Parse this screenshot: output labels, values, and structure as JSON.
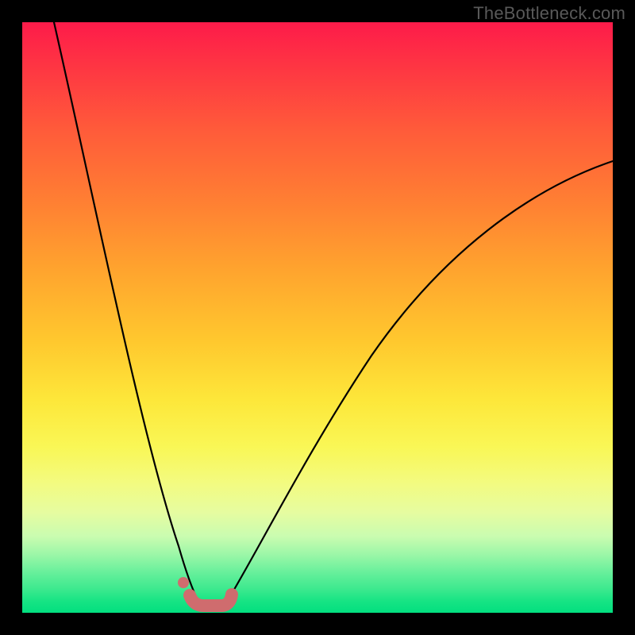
{
  "watermark": "TheBottleneck.com",
  "chart_data": {
    "type": "line",
    "title": "",
    "xlabel": "",
    "ylabel": "",
    "xlim": [
      0,
      1
    ],
    "ylim": [
      0,
      1
    ],
    "background_gradient": {
      "orientation": "vertical",
      "stops": [
        {
          "pos": 0.0,
          "color": "#fd1b4a"
        },
        {
          "pos": 0.18,
          "color": "#ff5a3a"
        },
        {
          "pos": 0.42,
          "color": "#ffa42e"
        },
        {
          "pos": 0.64,
          "color": "#fde73a"
        },
        {
          "pos": 0.83,
          "color": "#e6fca0"
        },
        {
          "pos": 1.0,
          "color": "#02df7f"
        }
      ]
    },
    "series": [
      {
        "name": "bottleneck-curve",
        "color": "#000000",
        "x": [
          0.05,
          0.1,
          0.15,
          0.2,
          0.23,
          0.26,
          0.28,
          0.3,
          0.32,
          0.34,
          0.36,
          0.4,
          0.45,
          0.5,
          0.55,
          0.6,
          0.65,
          0.7,
          0.75,
          0.8,
          0.85,
          0.9,
          0.95,
          1.0
        ],
        "y": [
          1.0,
          0.77,
          0.54,
          0.32,
          0.18,
          0.08,
          0.03,
          0.01,
          0.01,
          0.02,
          0.04,
          0.1,
          0.18,
          0.26,
          0.33,
          0.4,
          0.46,
          0.52,
          0.57,
          0.62,
          0.66,
          0.7,
          0.73,
          0.76
        ]
      }
    ],
    "highlight": {
      "name": "optimum-band",
      "color": "#cf6c6e",
      "x_range": [
        0.275,
        0.35
      ],
      "y": 0.012,
      "end_dot": {
        "x": 0.265,
        "y": 0.045
      }
    }
  }
}
